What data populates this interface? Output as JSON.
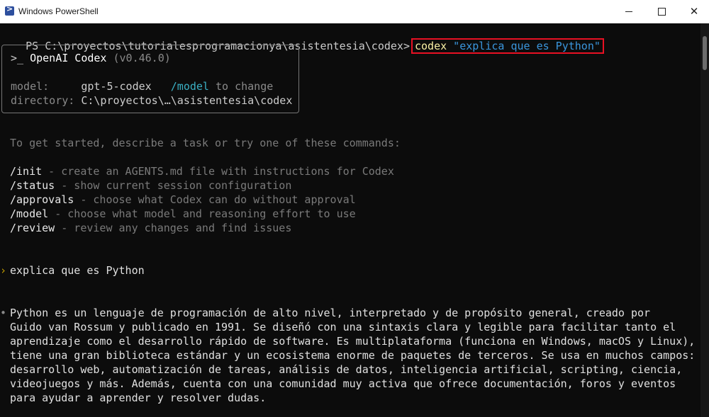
{
  "window": {
    "title": "Windows PowerShell",
    "controls": {
      "minimize": "minimize-icon",
      "maximize": "maximize-icon",
      "close": "close-icon"
    }
  },
  "prompt": {
    "path": "PS C:\\proyectos\\tutorialesprogramacionya\\asistentesia\\codex>",
    "command": "codex",
    "argument": "\"explica que es Python\""
  },
  "codex_box": {
    "chevron": ">_",
    "name": "OpenAI Codex",
    "version": "(v0.46.0)",
    "model_label": "model:",
    "model_value": "gpt-5-codex",
    "model_cmd": "/model",
    "model_hint": "to change",
    "dir_label": "directory:",
    "dir_value": "C:\\proyectos\\…\\asistentesia\\codex"
  },
  "intro": "To get started, describe a task or try one of these commands:",
  "commands": [
    {
      "cmd": "/init",
      "desc": " - create an AGENTS.md file with instructions for Codex"
    },
    {
      "cmd": "/status",
      "desc": " - show current session configuration"
    },
    {
      "cmd": "/approvals",
      "desc": " - choose what Codex can do without approval"
    },
    {
      "cmd": "/model",
      "desc": " - choose what model and reasoning effort to use"
    },
    {
      "cmd": "/review",
      "desc": " - review any changes and find issues"
    }
  ],
  "user_message": {
    "bullet": "›",
    "text": "explica que es Python"
  },
  "response": {
    "bullet": "•",
    "lines": [
      "Python es un lenguaje de programación de alto nivel, interpretado y de propósito general, creado por",
      "Guido van Rossum y publicado en 1991. Se diseñó con una sintaxis clara y legible para facilitar tanto el",
      "aprendizaje como el desarrollo rápido de software. Es multiplataforma (funciona en Windows, macOS y Linux),",
      "tiene una gran biblioteca estándar y un ecosistema enorme de paquetes de terceros. Se usa en muchos campos:",
      "desarrollo web, automatización de tareas, análisis de datos, inteligencia artificial, scripting, ciencia,",
      "videojuegos y más. Además, cuenta con una comunidad muy activa que ofrece documentación, foros y eventos",
      "para ayudar a aprender y resolver dudas."
    ]
  },
  "colors": {
    "background": "#0c0c0c",
    "highlight_border": "#e81123",
    "command_yellow": "#f9f1a5",
    "argument_blue": "#3a96dd",
    "cyan": "#3ab0c4"
  }
}
